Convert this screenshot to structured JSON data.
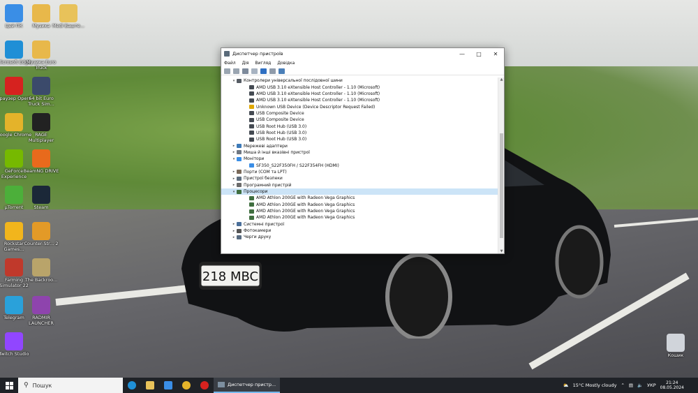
{
  "desktop": {
    "icons": [
      {
        "label": "Цей ПК",
        "icon": "computer-icon",
        "color": "#3a8ee6"
      },
      {
        "label": "Музика",
        "icon": "music-folder-icon",
        "color": "#e8b84a"
      },
      {
        "label": "Medi Ваште...",
        "icon": "folder-icon",
        "color": "#e8c25a"
      },
      {
        "label": "Microsoft Edge",
        "icon": "edge-icon",
        "color": "#1f8fd6"
      },
      {
        "label": "Музика Euro Truck",
        "icon": "music-folder-icon",
        "color": "#e8b84a"
      },
      {
        "label": "Браузер Opera",
        "icon": "opera-icon",
        "color": "#d6221f"
      },
      {
        "label": "64 bit Euro Truck Sim...",
        "icon": "ets-icon",
        "color": "#3b4a6b"
      },
      {
        "label": "Google Chrome",
        "icon": "chrome-icon",
        "color": "#e4b32a"
      },
      {
        "label": "RAGE Multiplayer",
        "icon": "ragemp-icon",
        "color": "#222222"
      },
      {
        "label": "GeForce Experience",
        "icon": "geforce-icon",
        "color": "#76b900"
      },
      {
        "label": "BeamNG DRIVE",
        "icon": "beamng-icon",
        "color": "#e86a1c"
      },
      {
        "label": "μTorrent",
        "icon": "utorrent-icon",
        "color": "#4caf3a"
      },
      {
        "label": "Steam",
        "icon": "steam-icon",
        "color": "#1b2838"
      },
      {
        "label": "Rockstar Games...",
        "icon": "rockstar-icon",
        "color": "#f2b51c"
      },
      {
        "label": "Counter-Str... 2",
        "icon": "cs2-icon",
        "color": "#e39a27"
      },
      {
        "label": "Farming Simulator 22",
        "icon": "farming-icon",
        "color": "#c0392b"
      },
      {
        "label": "The Backroo...",
        "icon": "backrooms-icon",
        "color": "#b9a46a"
      },
      {
        "label": "Telegram",
        "icon": "telegram-icon",
        "color": "#2aa1da"
      },
      {
        "label": "RADMIR LAUNCHER",
        "icon": "radmir-icon",
        "color": "#8e44ad"
      },
      {
        "label": "Twitch Studio",
        "icon": "twitch-icon",
        "color": "#9146ff"
      },
      {
        "label": "Кошик",
        "icon": "recycle-bin-icon",
        "color": "#d0d4da"
      }
    ]
  },
  "window": {
    "title": "Диспетчер пристроїв",
    "menu": [
      "Файл",
      "Дія",
      "Вигляд",
      "Довідка"
    ],
    "tree": [
      {
        "level": 0,
        "expanded": true,
        "icon": "usb-icon",
        "label": "Контролери універсальної послідовної шини"
      },
      {
        "level": 1,
        "icon": "usb-plug-icon",
        "label": "AMD USB 3.10 eXtensible Host Controller - 1.10 (Microsoft)"
      },
      {
        "level": 1,
        "icon": "usb-plug-icon",
        "label": "AMD USB 3.10 eXtensible Host Controller - 1.10 (Microsoft)"
      },
      {
        "level": 1,
        "icon": "usb-plug-icon",
        "label": "AMD USB 3.10 eXtensible Host Controller - 1.10 (Microsoft)"
      },
      {
        "level": 1,
        "icon": "warning-icon",
        "label": "Unknown USB Device (Device Descriptor Request Failed)"
      },
      {
        "level": 1,
        "icon": "usb-plug-icon",
        "label": "USB Composite Device"
      },
      {
        "level": 1,
        "icon": "usb-plug-icon",
        "label": "USB Composite Device"
      },
      {
        "level": 1,
        "icon": "usb-plug-icon",
        "label": "USB Root Hub (USB 3.0)"
      },
      {
        "level": 1,
        "icon": "usb-plug-icon",
        "label": "USB Root Hub (USB 3.0)"
      },
      {
        "level": 1,
        "icon": "usb-plug-icon",
        "label": "USB Root Hub (USB 3.0)"
      },
      {
        "level": 0,
        "expanded": false,
        "icon": "network-icon",
        "label": "Мережеві адаптери"
      },
      {
        "level": 0,
        "expanded": false,
        "icon": "mouse-icon",
        "label": "Миша й інші вказівні пристрої"
      },
      {
        "level": 0,
        "expanded": true,
        "icon": "monitor-icon",
        "label": "Монітори"
      },
      {
        "level": 1,
        "icon": "monitor-icon",
        "label": "SF350_S22F350FH / S22F354FH (HDMI)"
      },
      {
        "level": 0,
        "expanded": false,
        "icon": "port-icon",
        "label": "Порти (COM та LPT)"
      },
      {
        "level": 0,
        "expanded": false,
        "icon": "security-icon",
        "label": "Пристрої безпеки"
      },
      {
        "level": 0,
        "expanded": false,
        "icon": "software-icon",
        "label": "Програмний пристрій"
      },
      {
        "level": 0,
        "expanded": true,
        "icon": "cpu-icon",
        "label": "Процесори",
        "selected": true
      },
      {
        "level": 1,
        "icon": "cpu-icon",
        "label": "AMD Athlon 200GE with Radeon Vega Graphics"
      },
      {
        "level": 1,
        "icon": "cpu-icon",
        "label": "AMD Athlon 200GE with Radeon Vega Graphics"
      },
      {
        "level": 1,
        "icon": "cpu-icon",
        "label": "AMD Athlon 200GE with Radeon Vega Graphics"
      },
      {
        "level": 1,
        "icon": "cpu-icon",
        "label": "AMD Athlon 200GE with Radeon Vega Graphics"
      },
      {
        "level": 0,
        "expanded": false,
        "icon": "system-icon",
        "label": "Системні пристрої"
      },
      {
        "level": 0,
        "expanded": false,
        "icon": "camera-icon",
        "label": "Фотокамери"
      },
      {
        "level": 0,
        "expanded": false,
        "icon": "print-queue-icon",
        "label": "Черги друку"
      }
    ]
  },
  "taskbar": {
    "search_placeholder": "Пошук",
    "active_app": "Диспетчер пристр...",
    "weather": "15°C  Mostly cloudy",
    "language": "УКР",
    "time": "21:24",
    "date": "08.05.2024"
  },
  "plate": "218 MBC"
}
